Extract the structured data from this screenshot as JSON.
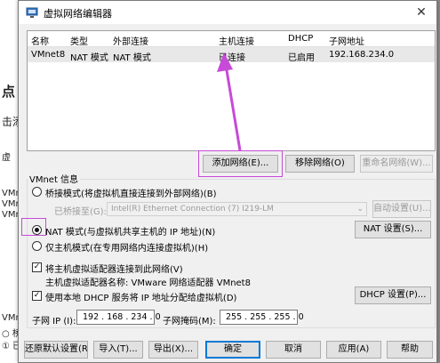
{
  "bg": {
    "left_texts": [
      "点",
      "击添",
      "虚",
      "VMne",
      "VMne",
      "VMne",
      "VMnet",
      "○ 桥",
      "① 已"
    ]
  },
  "window": {
    "title": "虚拟网络编辑器",
    "close": "✕"
  },
  "table": {
    "headers": [
      "名称",
      "类型",
      "外部连接",
      "主机连接",
      "DHCP",
      "子网地址"
    ],
    "rows": [
      [
        "VMnet8",
        "NAT 模式",
        "NAT 模式",
        "已连接",
        "已启用",
        "192.168.234.0"
      ]
    ]
  },
  "buttons": {
    "add_network": "添加网络(E)...",
    "remove_network": "移除网络(O)",
    "rename_network": "重命名网络(W)...",
    "auto_settings": "自动设置(U)...",
    "nat_settings": "NAT 设置(S)...",
    "dhcp_settings": "DHCP 设置(P)...",
    "restore_defaults": "还原默认设置(R)",
    "import": "导入(T)...",
    "export": "导出(X)...",
    "ok": "确定",
    "cancel": "取消",
    "apply": "应用(A)",
    "help": "帮助"
  },
  "vmnet_info": {
    "group_label": "VMnet 信息",
    "bridged_label": "桥接模式(将虚拟机直接连接到外部网络)(B)",
    "bridged_to_label": "已桥接至(G):",
    "bridged_to_value": "Intel(R) Ethernet Connection (7) I219-LM",
    "nat_label": "NAT 模式(与虚拟机共享主机的 IP 地址)(N)",
    "hostonly_label": "仅主机模式(在专用网络内连接虚拟机)(H)",
    "connect_adapter_label": "将主机虚拟适配器连接到此网络(V)",
    "adapter_name_text": "主机虚拟适配器名称: VMware 网络适配器 VMnet8",
    "dhcp_label": "使用本地 DHCP 服务将 IP 地址分配给虚拟机(D)",
    "subnet_ip_label": "子网 IP (I):",
    "subnet_ip_value": "192 . 168 . 234 . 0",
    "subnet_mask_label": "子网掩码(M):",
    "subnet_mask_value": "255 . 255 . 255 . 0",
    "selected_mode": "nat",
    "connect_adapter_checked": true,
    "dhcp_checked": true
  },
  "colors": {
    "annotation": "#c74ad8",
    "accent": "#0078d7"
  }
}
